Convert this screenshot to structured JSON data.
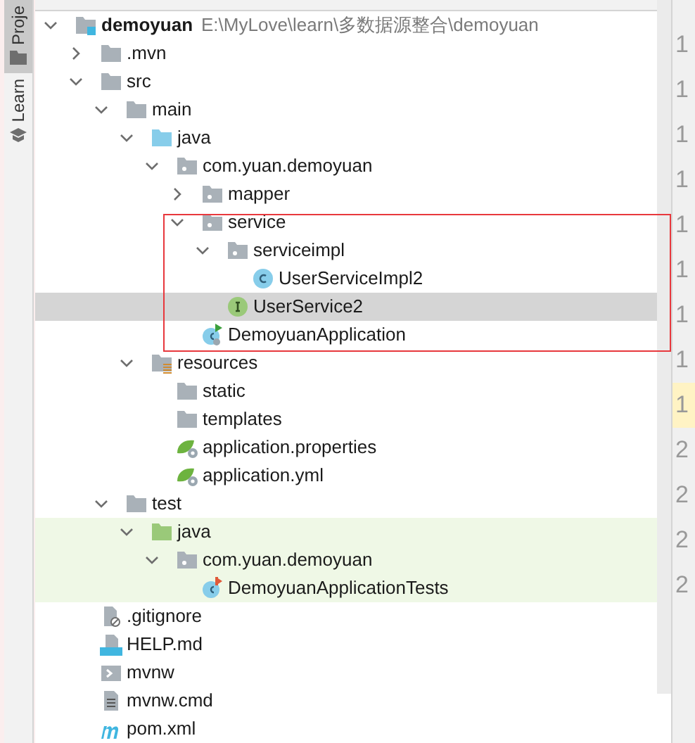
{
  "side_tabs": [
    {
      "label": "Proje",
      "selected": true,
      "kind": "project"
    },
    {
      "label": "Learn",
      "selected": false,
      "kind": "learn"
    }
  ],
  "tree": [
    {
      "name": "demoyuan",
      "path": "E:\\MyLove\\learn\\多数据源整合\\demoyuan",
      "kind": "module",
      "expanded": true,
      "selected": false,
      "test_scope": false,
      "children": [
        {
          "name": ".mvn",
          "kind": "folder",
          "expanded": false,
          "selected": false,
          "test_scope": false
        },
        {
          "name": "src",
          "kind": "folder",
          "expanded": true,
          "selected": false,
          "test_scope": false,
          "children": [
            {
              "name": "main",
              "kind": "folder",
              "expanded": true,
              "selected": false,
              "test_scope": false,
              "children": [
                {
                  "name": "java",
                  "kind": "source_root",
                  "expanded": true,
                  "selected": false,
                  "test_scope": false,
                  "children": [
                    {
                      "name": "com.yuan.demoyuan",
                      "kind": "package",
                      "expanded": true,
                      "selected": false,
                      "test_scope": false,
                      "children": [
                        {
                          "name": "mapper",
                          "kind": "package",
                          "expanded": false,
                          "selected": false,
                          "test_scope": false
                        },
                        {
                          "name": "service",
                          "kind": "package",
                          "expanded": true,
                          "selected": false,
                          "test_scope": false,
                          "children": [
                            {
                              "name": "serviceimpl",
                              "kind": "package",
                              "expanded": true,
                              "selected": false,
                              "test_scope": false,
                              "children": [
                                {
                                  "name": "UserServiceImpl2",
                                  "kind": "class",
                                  "selected": false,
                                  "test_scope": false
                                }
                              ]
                            },
                            {
                              "name": "UserService2",
                              "kind": "interface",
                              "selected": true,
                              "test_scope": false
                            }
                          ]
                        },
                        {
                          "name": "DemoyuanApplication",
                          "kind": "spring_app",
                          "selected": false,
                          "test_scope": false
                        }
                      ]
                    }
                  ]
                },
                {
                  "name": "resources",
                  "kind": "resources_root",
                  "expanded": true,
                  "selected": false,
                  "test_scope": false,
                  "children": [
                    {
                      "name": "static",
                      "kind": "folder",
                      "selected": false,
                      "test_scope": false
                    },
                    {
                      "name": "templates",
                      "kind": "folder",
                      "selected": false,
                      "test_scope": false
                    },
                    {
                      "name": "application.properties",
                      "kind": "spring_config",
                      "selected": false,
                      "test_scope": false
                    },
                    {
                      "name": "application.yml",
                      "kind": "spring_config",
                      "selected": false,
                      "test_scope": false
                    }
                  ]
                }
              ]
            },
            {
              "name": "test",
              "kind": "folder",
              "expanded": true,
              "selected": false,
              "test_scope": false,
              "children": [
                {
                  "name": "java",
                  "kind": "test_root",
                  "expanded": true,
                  "selected": false,
                  "test_scope": true,
                  "children": [
                    {
                      "name": "com.yuan.demoyuan",
                      "kind": "package",
                      "expanded": true,
                      "selected": false,
                      "test_scope": true,
                      "children": [
                        {
                          "name": "DemoyuanApplicationTests",
                          "kind": "test_class",
                          "selected": false,
                          "test_scope": true
                        }
                      ]
                    }
                  ]
                }
              ]
            }
          ]
        },
        {
          "name": ".gitignore",
          "kind": "ignore_file",
          "selected": false,
          "test_scope": false
        },
        {
          "name": "HELP.md",
          "kind": "markdown",
          "selected": false,
          "test_scope": false
        },
        {
          "name": "mvnw",
          "kind": "script",
          "selected": false,
          "test_scope": false
        },
        {
          "name": "mvnw.cmd",
          "kind": "text_file",
          "selected": false,
          "test_scope": false
        },
        {
          "name": "pom.xml",
          "kind": "maven",
          "selected": false,
          "test_scope": false
        }
      ]
    }
  ],
  "gutter": [
    {
      "text": "1",
      "current": false
    },
    {
      "text": "1",
      "current": false
    },
    {
      "text": "1",
      "current": false
    },
    {
      "text": "1",
      "current": false
    },
    {
      "text": "1",
      "current": false
    },
    {
      "text": "1",
      "current": false
    },
    {
      "text": "1",
      "current": false
    },
    {
      "text": "1",
      "current": false
    },
    {
      "text": "1",
      "current": true
    },
    {
      "text": "2",
      "current": false
    },
    {
      "text": "2",
      "current": false
    },
    {
      "text": "2",
      "current": false
    },
    {
      "text": "2",
      "current": false
    }
  ]
}
